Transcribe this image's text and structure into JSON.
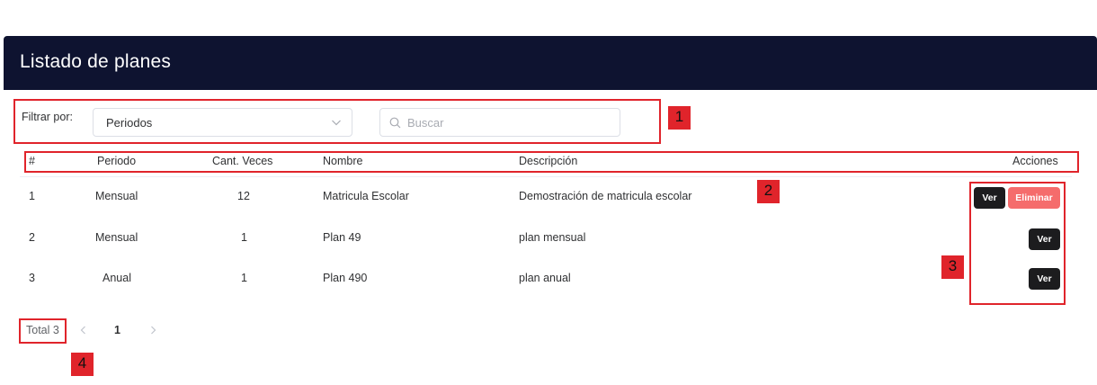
{
  "header": {
    "title": "Listado de planes"
  },
  "filter": {
    "label": "Filtrar por:",
    "select_value": "Periodos",
    "search_placeholder": "Buscar"
  },
  "table": {
    "columns": [
      "#",
      "Periodo",
      "Cant. Veces",
      "Nombre",
      "Descripción",
      "Acciones"
    ],
    "rows": [
      {
        "index": "1",
        "periodo": "Mensual",
        "cant": "12",
        "nombre": "Matricula Escolar",
        "descripcion": "Demostración de matricula escolar",
        "actions": [
          "Ver",
          "Eliminar"
        ]
      },
      {
        "index": "2",
        "periodo": "Mensual",
        "cant": "1",
        "nombre": "Plan 49",
        "descripcion": "plan mensual",
        "actions": [
          "Ver"
        ]
      },
      {
        "index": "3",
        "periodo": "Anual",
        "cant": "1",
        "nombre": "Plan 490",
        "descripcion": "plan anual",
        "actions": [
          "Ver"
        ]
      }
    ]
  },
  "pagination": {
    "total_label": "Total 3",
    "current_page": "1"
  },
  "annotations": [
    "1",
    "2",
    "3",
    "4"
  ],
  "colors": {
    "header_bg": "#0e1330",
    "annotation": "#e0242b",
    "danger": "#f56c6c",
    "dark_button": "#1c1c1e"
  }
}
